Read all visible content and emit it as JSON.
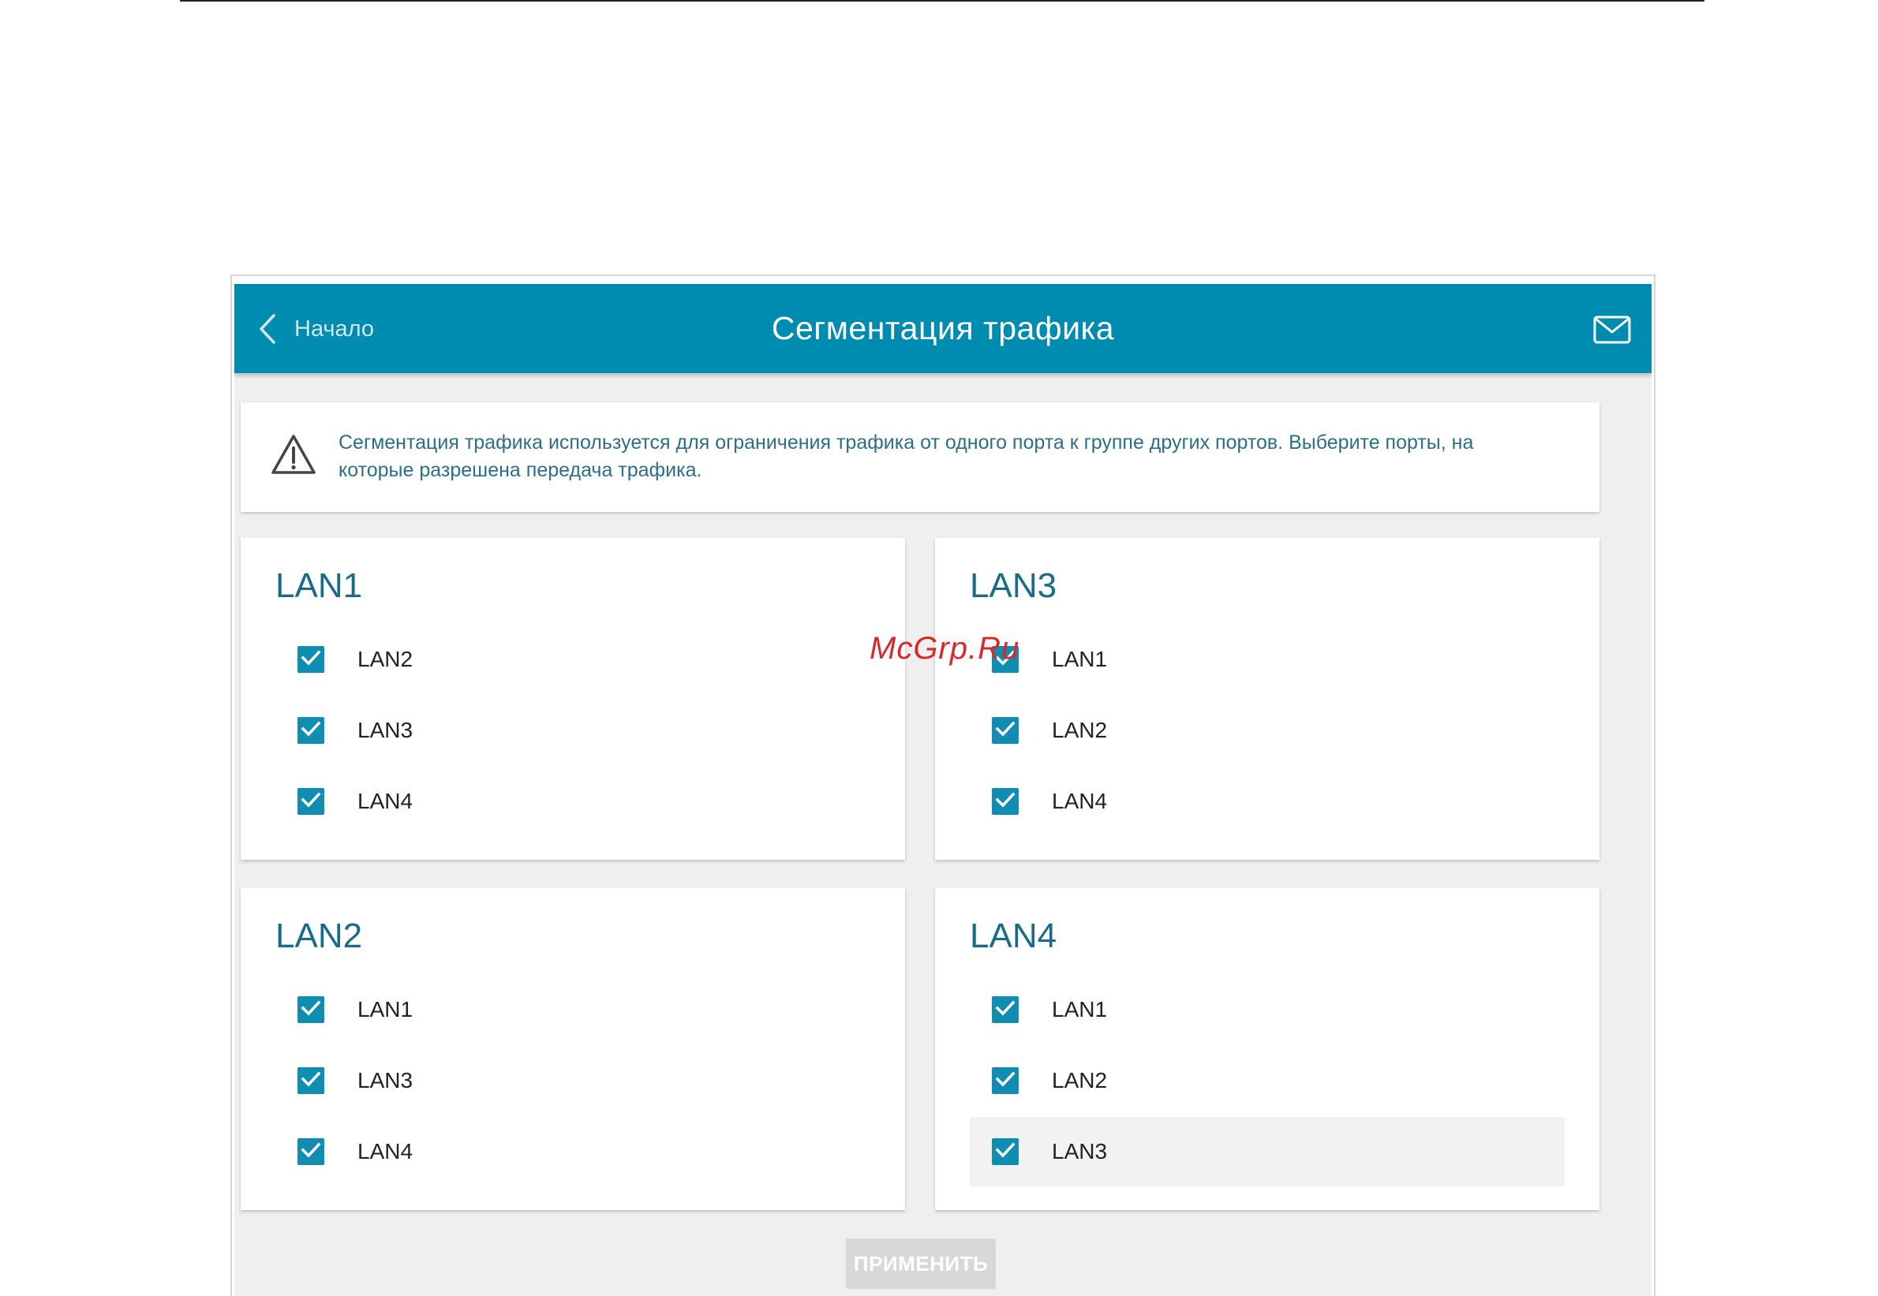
{
  "header": {
    "back_label": "Начало",
    "title": "Сегментация трафика"
  },
  "info": {
    "text_line1": "Сегментация трафика используется для ограничения трафика от одного порта к группе других портов. Выберите порты, на",
    "text_line2": "которые разрешена передача трафика."
  },
  "cards": [
    {
      "title": "LAN1",
      "options": [
        {
          "label": "LAN2",
          "checked": true
        },
        {
          "label": "LAN3",
          "checked": true
        },
        {
          "label": "LAN4",
          "checked": true
        }
      ]
    },
    {
      "title": "LAN3",
      "options": [
        {
          "label": "LAN1",
          "checked": true
        },
        {
          "label": "LAN2",
          "checked": true
        },
        {
          "label": "LAN4",
          "checked": true
        }
      ]
    },
    {
      "title": "LAN2",
      "options": [
        {
          "label": "LAN1",
          "checked": true
        },
        {
          "label": "LAN3",
          "checked": true
        },
        {
          "label": "LAN4",
          "checked": true
        }
      ]
    },
    {
      "title": "LAN4",
      "options": [
        {
          "label": "LAN1",
          "checked": true
        },
        {
          "label": "LAN2",
          "checked": true
        },
        {
          "label": "LAN3",
          "checked": true
        }
      ]
    }
  ],
  "apply_label": "ПРИМЕНИТЬ",
  "watermark": "McGrp.Ru",
  "colors": {
    "header_bg": "#008bb0",
    "checkbox": "#0f8db3",
    "title_text": "#1a6a8a",
    "info_text": "#2b6e8c",
    "watermark": "#d9282a"
  }
}
